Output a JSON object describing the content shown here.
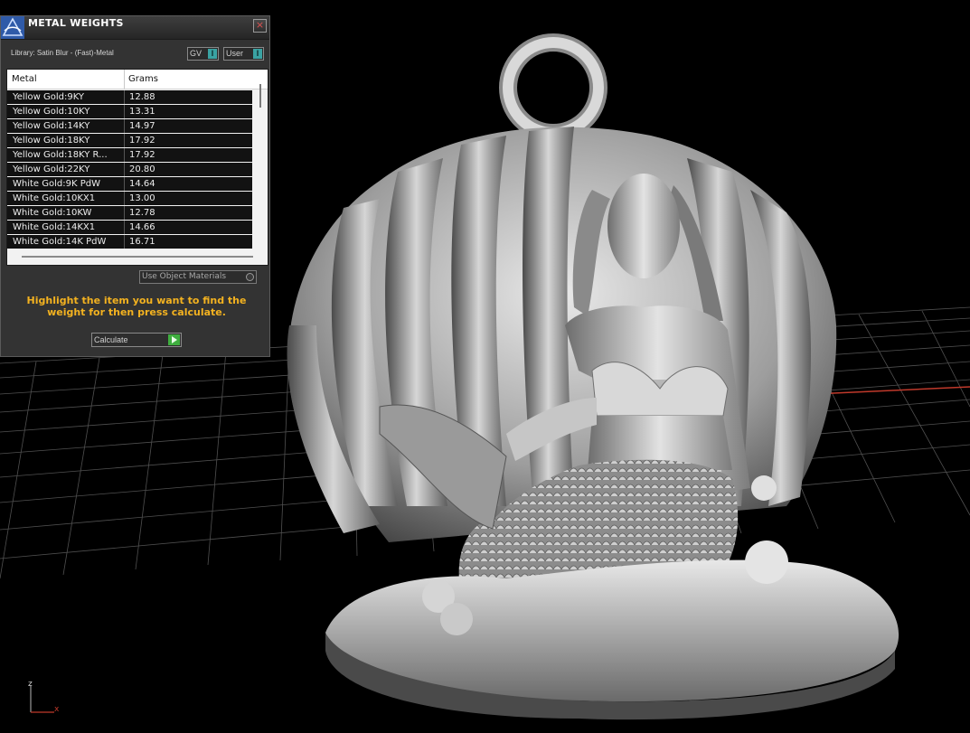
{
  "panel": {
    "title": "METAL WEIGHTS",
    "close_symbol": "×",
    "library_label": "Library: Satin Blur - (Fast)-Metal",
    "gv_toggle": {
      "label": "GV",
      "knob": "I"
    },
    "user_toggle": {
      "label": "User",
      "knob": "I"
    },
    "table": {
      "columns": [
        "Metal",
        "Grams"
      ],
      "rows": [
        [
          "Yellow Gold:9KY",
          "12.88"
        ],
        [
          "Yellow Gold:10KY",
          "13.31"
        ],
        [
          "Yellow Gold:14KY",
          "14.97"
        ],
        [
          "Yellow Gold:18KY",
          "17.92"
        ],
        [
          "Yellow Gold:18KY R...",
          "17.92"
        ],
        [
          "Yellow Gold:22KY",
          "20.80"
        ],
        [
          "White Gold:9K PdW",
          "14.64"
        ],
        [
          "White Gold:10KX1",
          "13.00"
        ],
        [
          "White Gold:10KW",
          "12.78"
        ],
        [
          "White Gold:14KX1",
          "14.66"
        ],
        [
          "White Gold:14K PdW",
          "16.71"
        ]
      ]
    },
    "use_object_materials": "Use Object Materials",
    "hint": "Highlight the item you want to find the weight for then press calculate.",
    "calculate_label": "Calculate"
  },
  "axis": {
    "z": "z",
    "x": "x"
  },
  "colors": {
    "hint": "#f3b220",
    "toggle_accent": "#3aa3a3",
    "calculate_accent": "#3fae3f",
    "axis_red": "#c0392b",
    "grid": "#5a5a5a"
  }
}
